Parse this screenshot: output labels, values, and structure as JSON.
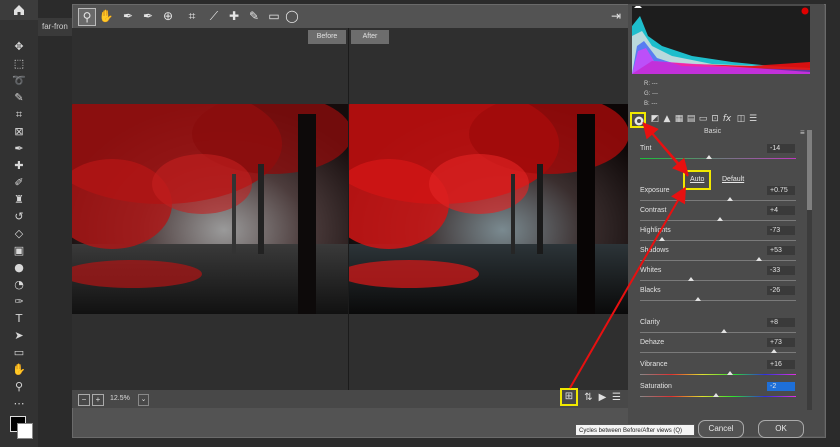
{
  "app": {
    "document_tab": "far-fron",
    "tools": [
      "move-icon",
      "marquee-icon",
      "lasso-icon",
      "quick-select-icon",
      "crop-icon",
      "frame-icon",
      "eyedropper-icon",
      "healing-icon",
      "brush-icon",
      "stamp-icon",
      "history-brush-icon",
      "eraser-icon",
      "gradient-icon",
      "blur-icon",
      "dodge-icon",
      "pen-icon",
      "type-icon",
      "path-select-icon",
      "rectangle-icon",
      "hand-icon",
      "zoom-icon",
      "more-icon"
    ]
  },
  "camera_raw": {
    "view_labels": {
      "before": "Before",
      "after": "After"
    },
    "zoom_level": "12.5%",
    "rgb_readout": {
      "r": "R:",
      "g": "G:",
      "b": "B:",
      "r_val": "---",
      "g_val": "---",
      "b_val": "---"
    },
    "panel_title": "Basic",
    "auto_label": "Auto",
    "default_label": "Default",
    "sliders": [
      {
        "label": "Tint",
        "value": "-14",
        "pos": 0.44
      },
      {
        "label": "Exposure",
        "value": "+0.75",
        "pos": 0.58
      },
      {
        "label": "Contrast",
        "value": "+4",
        "pos": 0.51
      },
      {
        "label": "Highlights",
        "value": "-73",
        "pos": 0.14
      },
      {
        "label": "Shadows",
        "value": "+53",
        "pos": 0.76
      },
      {
        "label": "Whites",
        "value": "-33",
        "pos": 0.33
      },
      {
        "label": "Blacks",
        "value": "-26",
        "pos": 0.37
      },
      {
        "label": "Clarity",
        "value": "+8",
        "pos": 0.54
      },
      {
        "label": "Dehaze",
        "value": "+73",
        "pos": 0.86
      },
      {
        "label": "Vibrance",
        "value": "+16",
        "pos": 0.58
      },
      {
        "label": "Saturation",
        "value": "-2",
        "pos": 0.49
      }
    ],
    "tooltip": "Cycles between Before/After views (Q)",
    "cancel_label": "Cancel",
    "ok_label": "OK"
  }
}
